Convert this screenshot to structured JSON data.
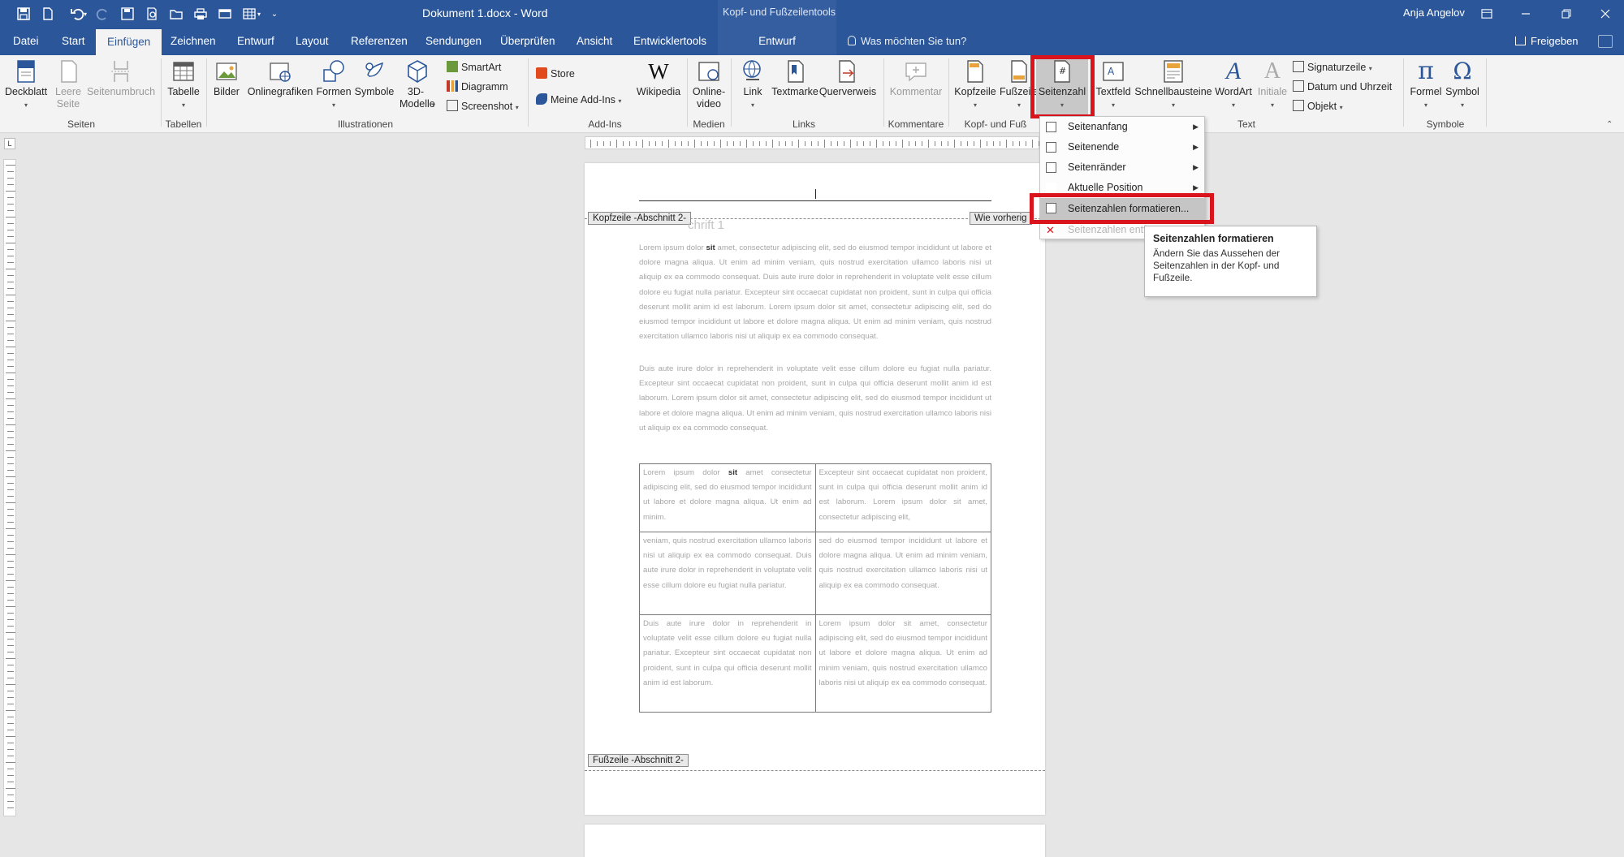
{
  "window": {
    "doc_title": "Dokument 1.docx  -  Word",
    "tools_title": "Kopf- und Fußzeilentools",
    "user": "Anja Angelov"
  },
  "tabs": {
    "file": "Datei",
    "start": "Start",
    "insert": "Einfügen",
    "draw": "Zeichnen",
    "design": "Entwurf",
    "layout": "Layout",
    "references": "Referenzen",
    "mailings": "Sendungen",
    "review": "Überprüfen",
    "view": "Ansicht",
    "developer": "Entwicklertools",
    "hf_design": "Entwurf",
    "tell_me": "Was möchten Sie tun?",
    "share": "Freigeben"
  },
  "ribbon": {
    "cover": "Deckblatt",
    "blank_page": "Leere Seite",
    "page_break": "Seitenumbruch",
    "table": "Tabelle",
    "pictures": "Bilder",
    "online_pictures": "Onlinegrafiken",
    "shapes": "Formen",
    "icons": "Symbole",
    "models3d": "3D-Modelle",
    "smartart": "SmartArt",
    "chart": "Diagramm",
    "screenshot": "Screenshot",
    "store": "Store",
    "my_addins": "Meine Add-Ins",
    "wikipedia": "Wikipedia",
    "online_video": "Online-video",
    "link": "Link",
    "bookmark": "Textmarke",
    "crossref": "Querverweis",
    "comment": "Kommentar",
    "header": "Kopfzeile",
    "footer": "Fußzeile",
    "page_number": "Seitenzahl",
    "textbox": "Textfeld",
    "quick_parts": "Schnellbausteine",
    "wordart": "WordArt",
    "dropcap": "Initiale",
    "signature": "Signaturzeile",
    "datetime": "Datum und Uhrzeit",
    "object": "Objekt",
    "equation": "Formel",
    "symbol": "Symbol",
    "groups": {
      "pages": "Seiten",
      "tables": "Tabellen",
      "illustrations": "Illustrationen",
      "addins": "Add-Ins",
      "media": "Medien",
      "links": "Links",
      "comments": "Kommentare",
      "header_footer": "Kopf- und Fuß",
      "text": "Text",
      "symbols": "Symbole"
    }
  },
  "menu": {
    "items": [
      {
        "label": "Seitenanfang"
      },
      {
        "label": "Seitenende"
      },
      {
        "label": "Seitenränder"
      },
      {
        "label": "Aktuelle Position"
      },
      {
        "label": "Seitenzahlen formatieren..."
      },
      {
        "label": "Seitenzahlen entf"
      }
    ]
  },
  "tooltip": {
    "title": "Seitenzahlen formatieren",
    "body": "Ändern Sie das Aussehen der Seitenzahlen in der Kopf- und Fußzeile."
  },
  "doc": {
    "header_tag": "Kopfzeile -Abschnitt 2-",
    "same_as_prev": "Wie vorherig",
    "heading_ghost": "chrift 1",
    "footer_tag": "Fußzeile -Abschnitt 2-",
    "para1_a": "Lorem ipsum dolor ",
    "para1_bold": "sit",
    "para1_b": " amet, consectetur adipiscing elit, sed do eiusmod tempor incididunt ut labore et dolore magna aliqua. Ut enim ad minim veniam, quis nostrud exercitation ullamco laboris nisi ut aliquip ex ea commodo consequat. Duis aute irure dolor in reprehenderit in voluptate velit esse cillum dolore eu fugiat nulla pariatur. Excepteur sint occaecat cupidatat non proident, sunt in culpa qui officia deserunt mollit anim id est laborum. Lorem ipsum dolor sit amet, consectetur adipiscing elit, sed do eiusmod tempor incididunt ut labore et dolore magna aliqua. Ut enim ad minim veniam, quis nostrud exercitation ullamco laboris nisi ut aliquip ex ea commodo consequat.",
    "para2": "Duis aute irure dolor in reprehenderit in voluptate velit esse cillum dolore eu fugiat nulla pariatur. Excepteur sint occaecat cupidatat non proident, sunt in culpa qui officia deserunt mollit anim id est laborum. Lorem ipsum dolor sit amet, consectetur adipiscing elit, sed do eiusmod tempor incididunt ut labore et dolore magna aliqua. Ut enim ad minim veniam, quis nostrud exercitation ullamco laboris nisi ut aliquip ex ea commodo consequat.",
    "table": {
      "r1c1_a": "Lorem ipsum dolor ",
      "r1c1_bold": "sit",
      "r1c1_b": " amet consectetur adipiscing elit, sed do eiusmod tempor incididunt ut labore et dolore magna aliqua. Ut enim ad minim.",
      "r1c2": "Excepteur sint occaecat cupidatat non proident, sunt in culpa qui officia deserunt mollit anim id est laborum. Lorem ipsum dolor sit amet, consectetur adipiscing elit,",
      "r2c1": "veniam, quis nostrud exercitation ullamco laboris nisi ut aliquip ex ea commodo consequat. Duis aute irure dolor in reprehenderit in voluptate velit esse cillum dolore eu fugiat nulla pariatur.",
      "r2c2": "sed do eiusmod tempor incididunt ut labore et dolore magna aliqua. Ut enim ad minim veniam, quis nostrud exercitation ullamco laboris nisi ut aliquip ex ea commodo consequat.",
      "r3c1": "Duis aute irure dolor in reprehenderit in voluptate velit esse cillum dolore eu fugiat nulla pariatur. Excepteur sint occaecat cupidatat non proident, sunt in culpa qui officia deserunt mollit anim id est laborum.",
      "r3c2": "Lorem ipsum dolor sit amet, consectetur adipiscing elit, sed do eiusmod tempor incididunt ut labore et dolore magna aliqua. Ut enim ad minim veniam, quis nostrud exercitation ullamco laboris nisi ut aliquip ex ea commodo consequat."
    }
  },
  "colors": {
    "word_blue": "#2b579a",
    "highlight_red": "#d9141d"
  }
}
